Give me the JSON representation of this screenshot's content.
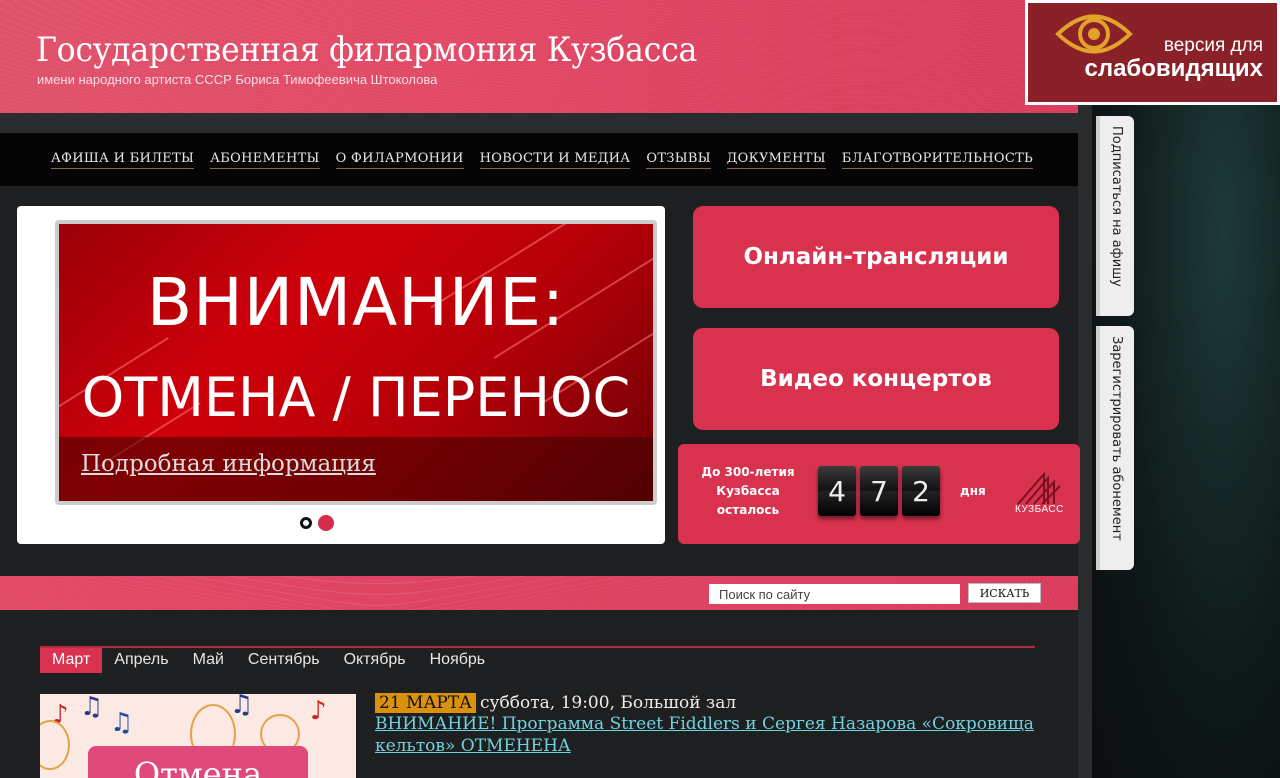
{
  "header": {
    "title": "Государственная филармония Кузбасса",
    "subtitle": "имени народного артиста СССР Бориса Тимофеевича Штоколова"
  },
  "accessibility": {
    "line1": "версия для",
    "line2": "слабовидящих",
    "icon": "eye-icon"
  },
  "nav": {
    "items": [
      "АФИША И БИЛЕТЫ",
      "АБОНЕМЕНТЫ",
      "О ФИЛАРМОНИИ",
      "НОВОСТИ И МЕДИА",
      "ОТЗЫВЫ",
      "ДОКУМЕНТЫ",
      "БЛАГОТВОРИТЕЛЬНОСТЬ"
    ]
  },
  "slider": {
    "headline": "ВНИМАНИЕ:",
    "subheadline": "ОТМЕНА / ПЕРЕНОС",
    "caption_link": "Подробная информация",
    "active_slide": 2
  },
  "buttons": {
    "online": "Онлайн-трансляции",
    "video": "Видео концертов"
  },
  "countdown": {
    "label_line1": "До 300-летия",
    "label_line2": "Кузбасса",
    "label_line3": "осталось",
    "digits": [
      "4",
      "7",
      "2"
    ],
    "unit": "дня",
    "logo_text": "КУЗБАСС"
  },
  "search": {
    "placeholder": "Поиск по сайту",
    "button": "ИСКАТЬ"
  },
  "months": {
    "items": [
      "Март",
      "Апрель",
      "Май",
      "Сентябрь",
      "Октябрь",
      "Ноябрь"
    ],
    "active": "Март"
  },
  "event": {
    "date": "21 МАРТА",
    "meta": "суббота, 19:00, Большой зал",
    "title": "ВНИМАНИЕ! Программа Street Fiddlers и Сергея Назарова «Сокровища кельтов» ОТМЕНЕНА",
    "image_banner": "Отмена"
  },
  "side_tabs": {
    "subscribe": "Подписаться на афишу",
    "register": "Зарегистрировать абонемент"
  },
  "colors": {
    "brand_red": "#d8324f",
    "nav_bg": "#050505",
    "access_bg": "#8b2128",
    "date_badge": "#d9910e",
    "link_teal": "#6fd4e0"
  }
}
